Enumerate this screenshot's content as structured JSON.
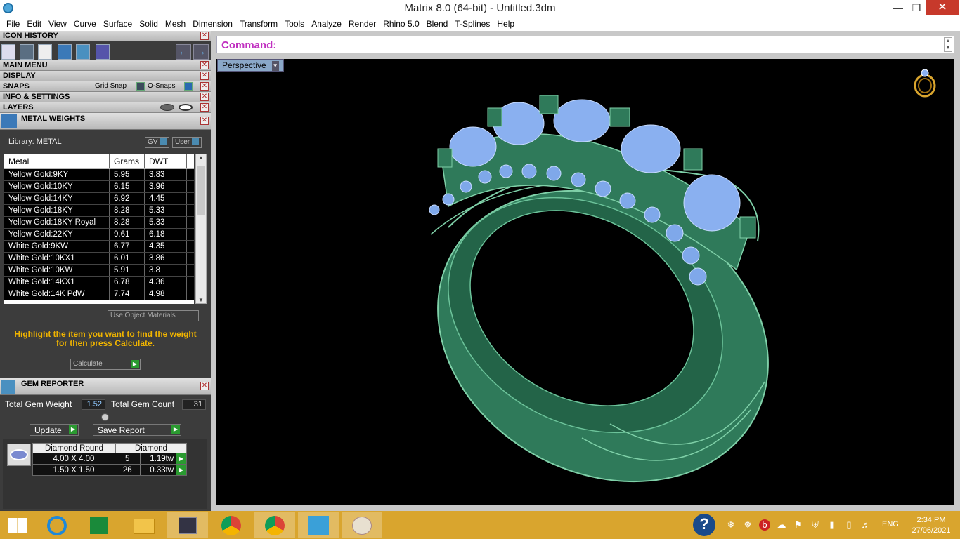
{
  "window": {
    "title": "Matrix 8.0 (64-bit) - Untitled.3dm"
  },
  "menu": [
    "File",
    "Edit",
    "View",
    "Curve",
    "Surface",
    "Solid",
    "Mesh",
    "Dimension",
    "Transform",
    "Tools",
    "Analyze",
    "Render",
    "Rhino 5.0",
    "Blend",
    "T-Splines",
    "Help"
  ],
  "panels": {
    "icon_history": "ICON HISTORY",
    "main_menu": "MAIN MENU",
    "display": "DISPLAY",
    "snaps": "SNAPS",
    "grid_snap": "Grid Snap",
    "o_snaps": "O-Snaps",
    "info": "INFO & SETTINGS",
    "layers": "LAYERS"
  },
  "metal_weights": {
    "title": "METAL WEIGHTS",
    "library": "Library: METAL",
    "gv": "GV",
    "user": "User",
    "columns": [
      "Metal",
      "Grams",
      "DWT"
    ],
    "rows": [
      [
        "Yellow Gold:9KY",
        "5.95",
        "3.83"
      ],
      [
        "Yellow Gold:10KY",
        "6.15",
        "3.96"
      ],
      [
        "Yellow Gold:14KY",
        "6.92",
        "4.45"
      ],
      [
        "Yellow Gold:18KY",
        "8.28",
        "5.33"
      ],
      [
        "Yellow Gold:18KY Royal",
        "8.28",
        "5.33"
      ],
      [
        "Yellow Gold:22KY",
        "9.61",
        "6.18"
      ],
      [
        "White Gold:9KW",
        "6.77",
        "4.35"
      ],
      [
        "White Gold:10KX1",
        "6.01",
        "3.86"
      ],
      [
        "White Gold:10KW",
        "5.91",
        "3.8"
      ],
      [
        "White Gold:14KX1",
        "6.78",
        "4.36"
      ],
      [
        "White Gold:14K PdW",
        "7.74",
        "4.98"
      ]
    ],
    "use_object_materials": "Use Object Materials",
    "hint": "Highlight the item you want to find the weight for then press Calculate.",
    "calculate": "Calculate"
  },
  "gem_reporter": {
    "title": "GEM REPORTER",
    "total_weight_label": "Total Gem Weight",
    "total_weight": "1.52",
    "total_count_label": "Total Gem Count",
    "total_count": "31",
    "update": "Update",
    "save_report": "Save Report",
    "head": [
      "Diamond Round",
      "Diamond"
    ],
    "rows": [
      [
        "4.00 X 4.00",
        "5",
        "1.19tw"
      ],
      [
        "1.50 X 1.50",
        "26",
        "0.33tw"
      ]
    ]
  },
  "command": {
    "label": "Command:",
    "value": ""
  },
  "viewport": {
    "name": "Perspective"
  },
  "taskbar": {
    "lang": "ENG",
    "time": "2:34 PM",
    "date": "27/06/2021"
  }
}
